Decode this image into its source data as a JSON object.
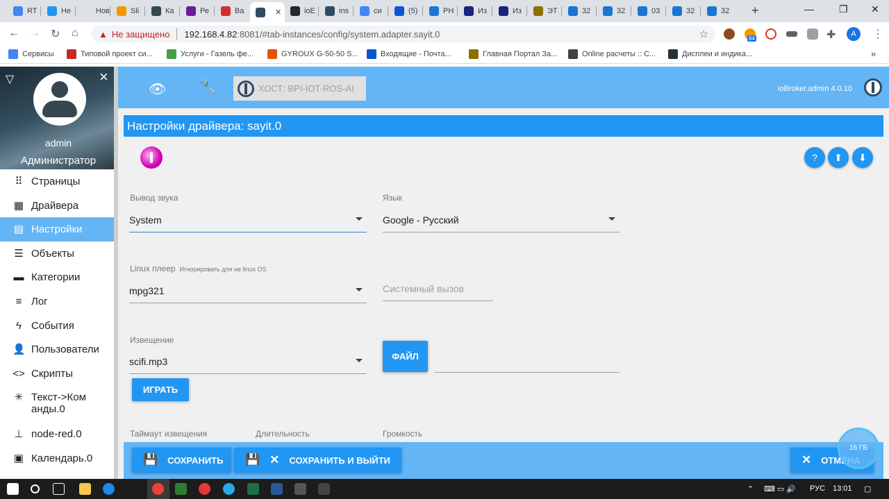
{
  "browser": {
    "tabs": [
      {
        "label": "RT",
        "color": "#4285f4"
      },
      {
        "label": "Не",
        "color": "#2196f3"
      },
      {
        "label": "Новая",
        "color": "#dee1e6"
      },
      {
        "label": "Sli",
        "color": "#f29900"
      },
      {
        "label": "Ка",
        "color": "#37474f"
      },
      {
        "label": "Ре",
        "color": "#6a1b9a"
      },
      {
        "label": "Ва",
        "color": "#d32f2f"
      },
      {
        "label": "",
        "color": "#2f4a63"
      },
      {
        "label": "ioE",
        "color": "#24292e"
      },
      {
        "label": "ins",
        "color": "#2f4a63"
      },
      {
        "label": "си",
        "color": "#4285f4"
      },
      {
        "label": "(5)",
        "color": "#0b57d0"
      },
      {
        "label": "РН",
        "color": "#1976d2"
      },
      {
        "label": "Из",
        "color": "#1a237e"
      },
      {
        "label": "Из",
        "color": "#1a237e"
      },
      {
        "label": "ЭТ",
        "color": "#8d6e00"
      },
      {
        "label": "32",
        "color": "#1976d2"
      },
      {
        "label": "32",
        "color": "#1976d2"
      },
      {
        "label": "03",
        "color": "#1976d2"
      },
      {
        "label": "32",
        "color": "#1976d2"
      },
      {
        "label": "32",
        "color": "#1976d2"
      }
    ],
    "active_tab_close": "✕",
    "new_tab": "+",
    "security_label": "Не защищено",
    "url_host": "192.168.4.82",
    "url_rest": ":8081/#tab-instances/config/system.adapter.sayit.0",
    "bookmarks": [
      {
        "label": "Сервисы",
        "color": "#4285f4"
      },
      {
        "label": "Типовой проект си...",
        "color": "#c62828"
      },
      {
        "label": "Услуги - Газель фе...",
        "color": "#43a047"
      },
      {
        "label": "GYROUX G-50-50 S...",
        "color": "#e65100"
      },
      {
        "label": "Входящие - Почта...",
        "color": "#0b57d0"
      },
      {
        "label": "Главная Портал За...",
        "color": "#8d6e00"
      },
      {
        "label": "Online расчеты :: С...",
        "color": "#424242"
      },
      {
        "label": "Дисплеи и индика...",
        "color": "#263238"
      }
    ],
    "bookmarks_more": "»",
    "profile_initial": "A",
    "ext_badge": "64"
  },
  "sidebar": {
    "username": "admin",
    "role": "Администратор",
    "items": [
      {
        "label": "Страницы",
        "icon": "⠿"
      },
      {
        "label": "Драйвера",
        "icon": "▦"
      },
      {
        "label": "Настройки",
        "icon": "▤"
      },
      {
        "label": "Объекты",
        "icon": "☰"
      },
      {
        "label": "Категории",
        "icon": "▬"
      },
      {
        "label": "Лог",
        "icon": "≡"
      },
      {
        "label": "События",
        "icon": "ϟ"
      },
      {
        "label": "Пользователи",
        "icon": "👤"
      },
      {
        "label": "Скрипты",
        "icon": "<>"
      },
      {
        "label": "Текст->Команды.0",
        "icon": "✳"
      },
      {
        "label": "node-red.0",
        "icon": "⊥"
      },
      {
        "label": "Календарь.0",
        "icon": "▣"
      }
    ]
  },
  "header": {
    "host": "ХОСТ: BPI-IOT-ROS-AI",
    "version": "ioBroker.admin 4.0.10"
  },
  "panel": {
    "title": "Настройки драйвера: sayit.0",
    "output_label": "Вывод звука",
    "output_value": "System",
    "lang_label": "Язык",
    "lang_value": "Google - Русский",
    "player_label": "Linux плеер",
    "player_hint": "Игнорировать для не linux OS",
    "player_value": "mpg321",
    "syscall_placeholder": "Системный вызов",
    "notify_label": "Извещение",
    "notify_value": "scifi.mp3",
    "file_button": "ФАЙЛ",
    "play_button": "ИГРАТЬ",
    "timeout_label": "Таймаут извещения",
    "duration_label": "Длительность",
    "volume_label": "Громкость"
  },
  "footer": {
    "save": "СОХРАНИТЬ",
    "save_exit": "СОХРАНИТЬ И ВЫЙТИ",
    "cancel": "ОТМЕНА"
  },
  "memory": "16 ГБ",
  "taskbar": {
    "lang": "РУС",
    "time": "13:01"
  }
}
